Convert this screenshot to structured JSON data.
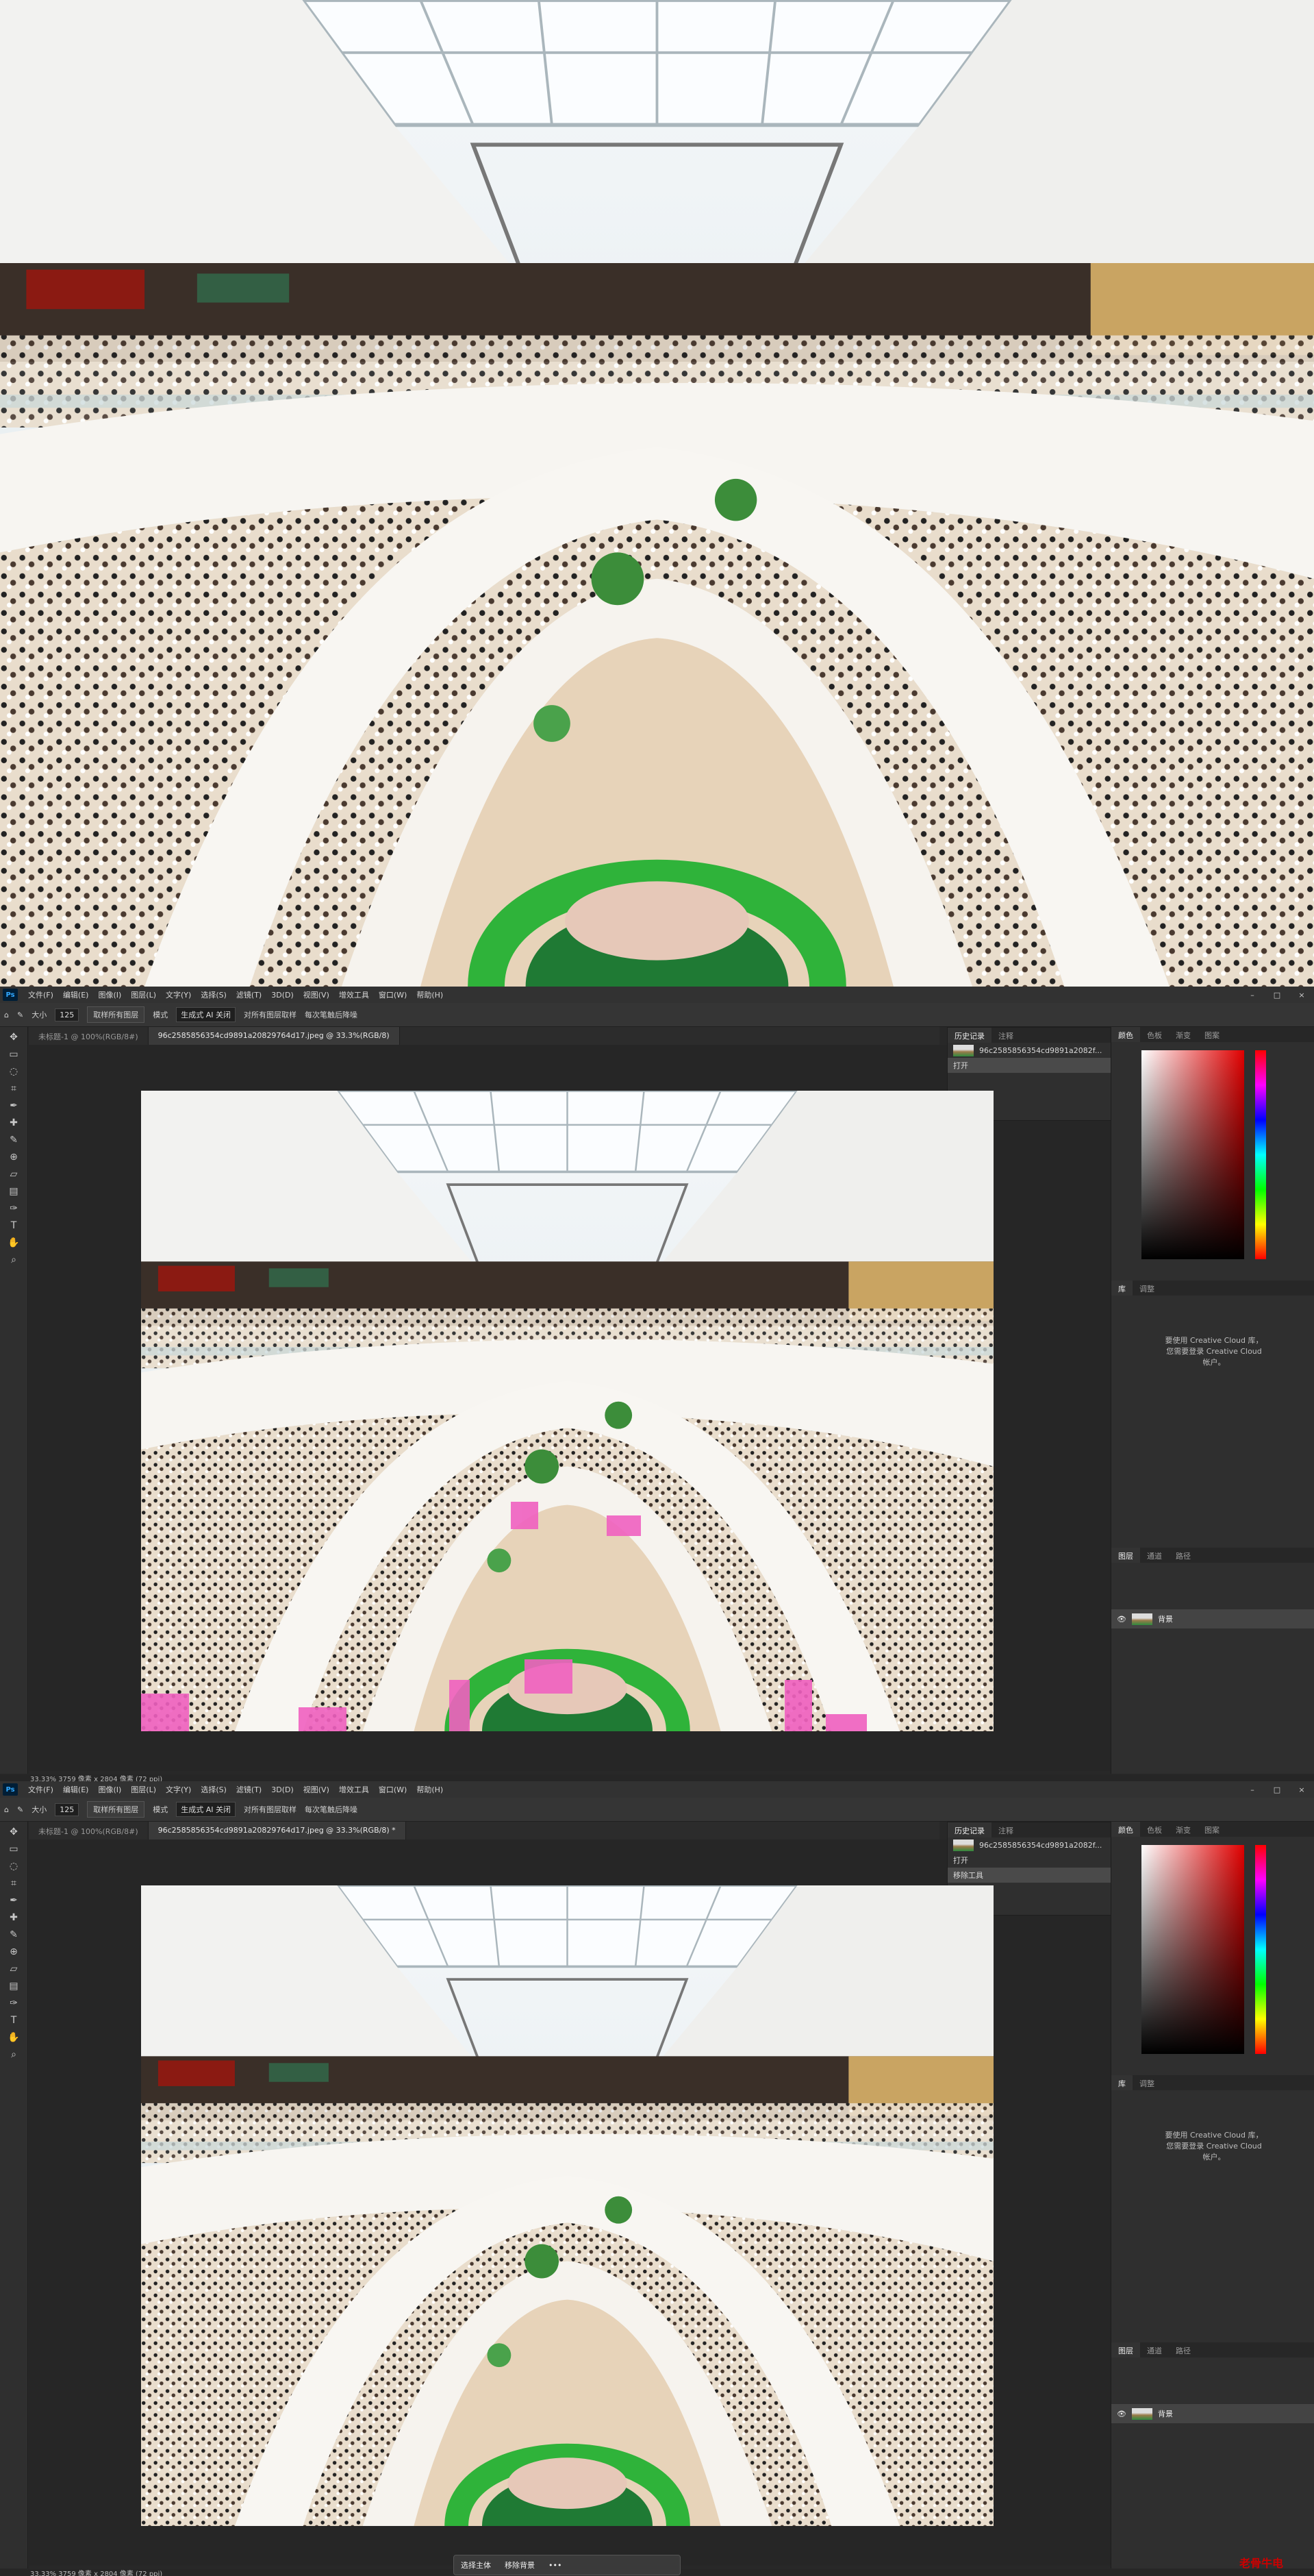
{
  "app": {
    "menu": [
      "文件(F)",
      "编辑(E)",
      "图像(I)",
      "图层(L)",
      "文字(Y)",
      "选择(S)",
      "滤镜(T)",
      "3D(D)",
      "视图(V)",
      "增效工具",
      "窗口(W)",
      "帮助(H)"
    ],
    "window_controls": [
      "–",
      "□",
      "×"
    ]
  },
  "options_bar": {
    "size_label": "大小",
    "size_value": "125",
    "mode_label": "模式",
    "mode_value": "生成式 AI 关闭",
    "btn_sample": "取样所有图层",
    "chk_all_layers": "对所有图层取样",
    "btn_repeat": "每次笔触后降噪"
  },
  "tabs_1": [
    {
      "label": "未标题-1 @ 100%(RGB/8#)",
      "active": false
    },
    {
      "label": "96c2585856354cd9891a20829764d17.jpeg @ 33.3%(RGB/8)",
      "active": true
    }
  ],
  "tabs_2": [
    {
      "label": "未标题-1 @ 100%(RGB/8#)",
      "active": false
    },
    {
      "label": "96c2585856354cd9891a20829764d17.jpeg @ 33.3%(RGB/8) *",
      "active": true
    }
  ],
  "history": {
    "tabs": [
      "历史记录",
      "注释"
    ],
    "file": "96c2585856354cd9891a2082f...",
    "steps_1": [
      "打开"
    ],
    "steps_2": [
      "打开",
      "移除工具"
    ]
  },
  "color_panel_tabs": [
    "颜色",
    "色板",
    "渐变",
    "图案"
  ],
  "props_tabs": [
    "库",
    "调整"
  ],
  "cc_message": "要使用 Creative Cloud 库，您需要登录 Creative Cloud 帐户。",
  "layers": {
    "tabs": [
      "图层",
      "通道",
      "路径"
    ],
    "layer_name": "背景"
  },
  "status_text": "33.33%   3759 像素 x 2804 像素 (72 ppi)",
  "ctx_bar": [
    "选择主体",
    "移除背景"
  ],
  "watermark": "老骨牛电"
}
